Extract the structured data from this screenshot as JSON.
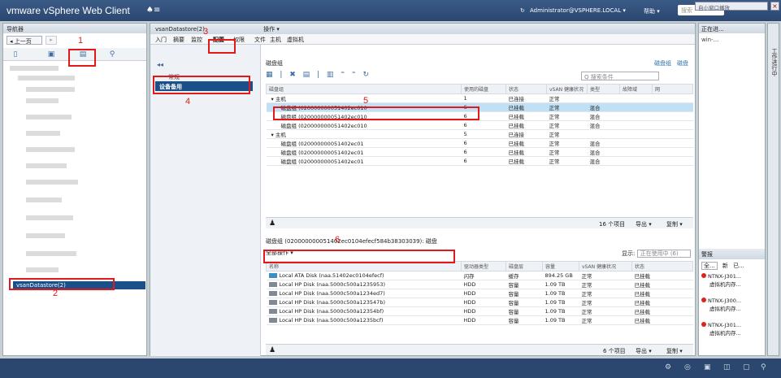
{
  "app": {
    "brand": "vmware vSphere Web Client",
    "home": "♠≡"
  },
  "topbar": {
    "user": "Administrator@VSPHERE.LOCAL ▾",
    "help": "帮助 ▾",
    "search_placeholder": "搜索",
    "popout": "自小窗口播放",
    "refresh": "↻"
  },
  "nav": {
    "title": "导航器",
    "back": "◂ 上一页",
    "fwd": "▸",
    "selected": "vsanDatastore(2)"
  },
  "main": {
    "title": "vsanDatastore(2)",
    "actions": "操作 ▾",
    "tabs": [
      "入门",
      "摘要",
      "监控",
      "配置",
      "权限",
      "文件",
      "主机",
      "虚拟机"
    ],
    "sub": {
      "section": "常规",
      "selected": "设备备用"
    },
    "panel": {
      "title": "磁盘组",
      "links": [
        "磁盘组",
        "磁盘"
      ],
      "filter_placeholder": "Q 搜索条件",
      "columns": [
        "磁盘组",
        "使用的磁盘",
        "状态",
        "vSAN 健康状况",
        "类型",
        "故障域",
        "网"
      ],
      "rows": [
        [
          "▾ 主机",
          "1",
          "已连接",
          "正常",
          "",
          ""
        ],
        [
          "磁盘组 (020000000051402ec010",
          "6",
          "已挂载",
          "正常",
          "混合",
          ""
        ],
        [
          "磁盘组 (020000000051402ec010",
          "6",
          "已挂载",
          "正常",
          "混合",
          ""
        ],
        [
          "磁盘组 (020000000051402ec010",
          "6",
          "已挂载",
          "正常",
          "混合",
          ""
        ],
        [
          "▾ 主机",
          "5",
          "已连接",
          "正常",
          "",
          ""
        ],
        [
          "磁盘组 (020000000051402ec01",
          "6",
          "已挂载",
          "正常",
          "混合",
          ""
        ],
        [
          "磁盘组 (020000000051402ec01",
          "6",
          "已挂载",
          "正常",
          "混合",
          ""
        ],
        [
          "磁盘组 (020000000051402ec01",
          "6",
          "已挂载",
          "正常",
          "混合",
          ""
        ]
      ],
      "footer": {
        "count": "16 个项目",
        "export": "导出 ▾",
        "copy": "复制 ▾"
      },
      "bottom_title": "磁盘组 (020000000051402ec0104efecf584b38303039): 磁盘",
      "bottom_action": "全部操作 ▾",
      "show_label": "显示:",
      "show_value": "正在使用中 (6)",
      "disk_columns": [
        "名称",
        "驱动器类型",
        "磁盘层",
        "容量",
        "vSAN 健康状况",
        "状态"
      ],
      "disks": [
        {
          "name": "Local ATA Disk (naa.51402ec0104efecf)",
          "type": "闪存",
          "tier": "缓存",
          "cap": "894.25 GB",
          "health": "正常",
          "state": "已挂载",
          "ssd": true
        },
        {
          "name": "Local HP Disk (naa.5000c500a1235953)",
          "type": "HDD",
          "tier": "容量",
          "cap": "1.09 TB",
          "health": "正常",
          "state": "已挂载",
          "ssd": false
        },
        {
          "name": "Local HP Disk (naa.5000c500a1234ed7)",
          "type": "HDD",
          "tier": "容量",
          "cap": "1.09 TB",
          "health": "正常",
          "state": "已挂载",
          "ssd": false
        },
        {
          "name": "Local HP Disk (naa.5000c500a123547b)",
          "type": "HDD",
          "tier": "容量",
          "cap": "1.09 TB",
          "health": "正常",
          "state": "已挂载",
          "ssd": false
        },
        {
          "name": "Local HP Disk (naa.5000c500a12354bf)",
          "type": "HDD",
          "tier": "容量",
          "cap": "1.09 TB",
          "health": "正常",
          "state": "已挂载",
          "ssd": false
        },
        {
          "name": "Local HP Disk (naa.5000c500a1235bcf)",
          "type": "HDD",
          "tier": "容量",
          "cap": "1.09 TB",
          "health": "正常",
          "state": "已挂载",
          "ssd": false
        }
      ],
      "bottom_footer": {
        "count": "6 个项目",
        "export": "导出 ▾",
        "copy": "复制 ▾"
      }
    }
  },
  "right": {
    "title": "正在进...",
    "task": "win-...",
    "vertical": "工作进行中",
    "alarms_title": "警报",
    "alarm_tabs": [
      "全...",
      "新",
      "已..."
    ],
    "alarms": [
      {
        "line1": "NTNX-J301...",
        "line2": "虚拟机内存..."
      },
      {
        "line1": "NTNX-J300...",
        "line2": "虚拟机内存..."
      },
      {
        "line1": "NTNX-J301...",
        "line2": "虚拟机内存..."
      }
    ]
  },
  "annotations": [
    "1",
    "2",
    "3",
    "4",
    "5",
    "6"
  ],
  "colors": {
    "accent": "#1a4f8a",
    "annotation": "#e0191b",
    "highlight": "#bfe0f5"
  }
}
